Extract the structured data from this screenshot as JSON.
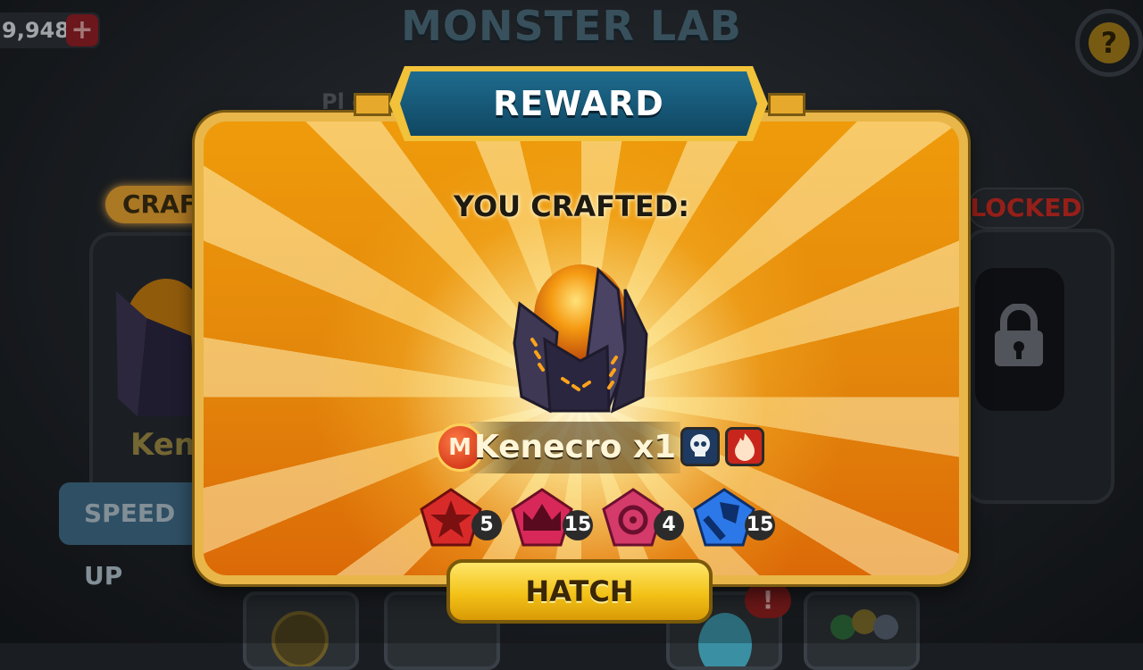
{
  "screen": {
    "title": "MONSTER LAB",
    "currency_value": "9,948",
    "add_currency_symbol": "+",
    "help_symbol": "?",
    "background_subtitle": "Pl                                    gg",
    "left_machine": {
      "status": "CRAFT",
      "egg_label": "Kenec",
      "speed_up_label": "SPEED UP"
    },
    "right_machine": {
      "status": "LOCKED"
    },
    "notification_symbol": "!"
  },
  "dialog": {
    "title": "REWARD",
    "heading": "YOU CRAFTED:",
    "reward_name": "Kenecro x1",
    "rarity_badge": "M",
    "elements": [
      "dark-skull-icon",
      "fire-icon"
    ],
    "runes": [
      {
        "icon": "red-star-rune-icon",
        "count": "5",
        "color": "#d92a2a"
      },
      {
        "icon": "crown-rune-icon",
        "count": "15",
        "color": "#d8285a"
      },
      {
        "icon": "target-rune-icon",
        "count": "4",
        "color": "#d43a6a"
      },
      {
        "icon": "axe-rune-icon",
        "count": "15",
        "color": "#2c78e8"
      }
    ],
    "hatch_label": "HATCH"
  },
  "colors": {
    "dialog_orange": "#e3860b",
    "banner_blue": "#0f4762",
    "hatch_yellow": "#f3c217"
  }
}
